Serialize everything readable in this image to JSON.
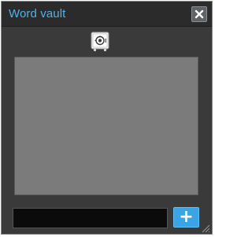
{
  "window": {
    "title": "Word vault"
  },
  "toolbar": {
    "close_icon": "close-icon",
    "vault_icon": "safe-icon"
  },
  "word_list": {
    "items": []
  },
  "input": {
    "value": "",
    "placeholder": ""
  },
  "add_button": {
    "label": "+"
  },
  "colors": {
    "title_text": "#4fb3ea",
    "window_bg": "#3a3a3a",
    "list_bg": "#7b7b7b",
    "input_bg": "#0b0b0b",
    "accent": "#3aa5e6"
  }
}
